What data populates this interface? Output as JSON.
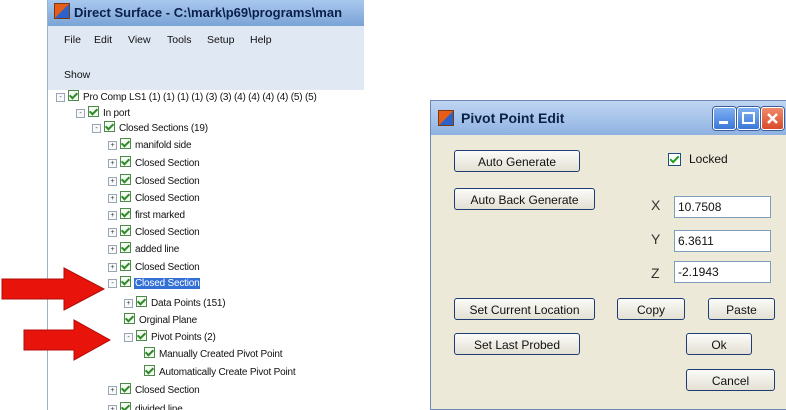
{
  "left_window": {
    "title": "Direct Surface - C:\\mark\\p69\\programs\\man",
    "menu": [
      "File",
      "Edit",
      "View",
      "Tools",
      "Setup",
      "Help"
    ],
    "show_label": "Show",
    "tree": [
      {
        "label": "Pro Comp LS1 (1) (1) (1) (1) (3) (3) (4) (4) (4) (4) (5) (5)",
        "expander": "-",
        "selected": false
      },
      {
        "label": "In port",
        "expander": "-",
        "selected": false
      },
      {
        "label": "Closed Sections (19)",
        "expander": "-",
        "selected": false
      },
      {
        "label": "manifold side",
        "expander": "+",
        "selected": false
      },
      {
        "label": "Closed Section",
        "expander": "+",
        "selected": false
      },
      {
        "label": "Closed Section",
        "expander": "+",
        "selected": false
      },
      {
        "label": "Closed Section",
        "expander": "+",
        "selected": false
      },
      {
        "label": "first marked",
        "expander": "+",
        "selected": false
      },
      {
        "label": "Closed Section",
        "expander": "+",
        "selected": false
      },
      {
        "label": "added line",
        "expander": "+",
        "selected": false
      },
      {
        "label": "Closed Section",
        "expander": "+",
        "selected": false
      },
      {
        "label": "Closed Section",
        "expander": "-",
        "selected": true
      },
      {
        "label": "Data Points (151)",
        "expander": "+",
        "selected": false
      },
      {
        "label": "Orginal Plane",
        "expander": "",
        "selected": false
      },
      {
        "label": "Pivot Points (2)",
        "expander": "-",
        "selected": false
      },
      {
        "label": "Manually Created Pivot Point",
        "expander": "",
        "selected": false
      },
      {
        "label": "Automatically Create Pivot Point",
        "expander": "",
        "selected": false
      },
      {
        "label": "Closed Section",
        "expander": "+",
        "selected": false
      },
      {
        "label": "divided line",
        "expander": "+",
        "selected": false
      }
    ]
  },
  "dialog": {
    "title": "Pivot Point Edit",
    "auto_generate": "Auto Generate",
    "auto_back_generate": "Auto Back Generate",
    "locked_label": "Locked",
    "locked_checked": true,
    "x_label": "X",
    "x_value": "10.7508",
    "y_label": "Y",
    "y_value": "6.3611",
    "z_label": "Z",
    "z_value": "-2.1943",
    "set_current_location": "Set Current Location",
    "copy": "Copy",
    "paste": "Paste",
    "set_last_probed": "Set Last Probed",
    "ok": "Ok",
    "cancel": "Cancel"
  },
  "colors": {
    "arrow": "#e8140c",
    "selection": "#3270d6",
    "dialog_bg": "#ece9d8"
  }
}
